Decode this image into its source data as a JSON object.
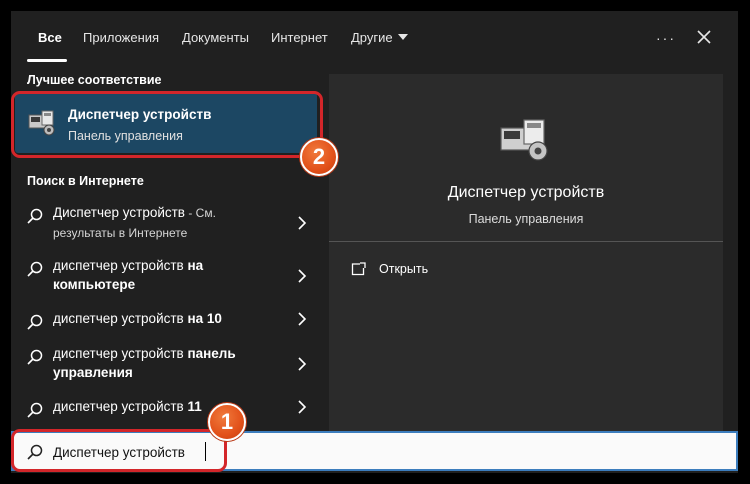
{
  "tabs": [
    {
      "label": "Все"
    },
    {
      "label": "Приложения"
    },
    {
      "label": "Документы"
    },
    {
      "label": "Интернет"
    },
    {
      "label": "Другие"
    }
  ],
  "toolbar": {
    "more_label": "···"
  },
  "left": {
    "best_match_title": "Лучшее соответствие",
    "best_match": {
      "title": "Диспетчер устройств",
      "subtitle": "Панель управления"
    },
    "web_title": "Поиск в Интернете",
    "web_results": [
      {
        "text": "Диспетчер устройств",
        "suffix": " - См.",
        "line2": "результаты в Интернете"
      },
      {
        "text": "диспетчер устройств",
        "bold": " на",
        "line2": "компьютере"
      },
      {
        "text": "диспетчер устройств",
        "bold": " на 10"
      },
      {
        "text": "диспетчер устройств",
        "bold": " панель",
        "line2": "управления"
      },
      {
        "text": "диспетчер устройств",
        "bold": " 11"
      }
    ]
  },
  "preview": {
    "title": "Диспетчер устройств",
    "subtitle": "Панель управления",
    "open_label": "Открыть"
  },
  "search": {
    "value": "Диспетчер устройств"
  },
  "markers": {
    "one": "1",
    "two": "2"
  },
  "colors": {
    "accent": "#1c4763",
    "highlight": "#d3262a",
    "marker": "#e2511a",
    "search_border": "#3c7dbd"
  }
}
